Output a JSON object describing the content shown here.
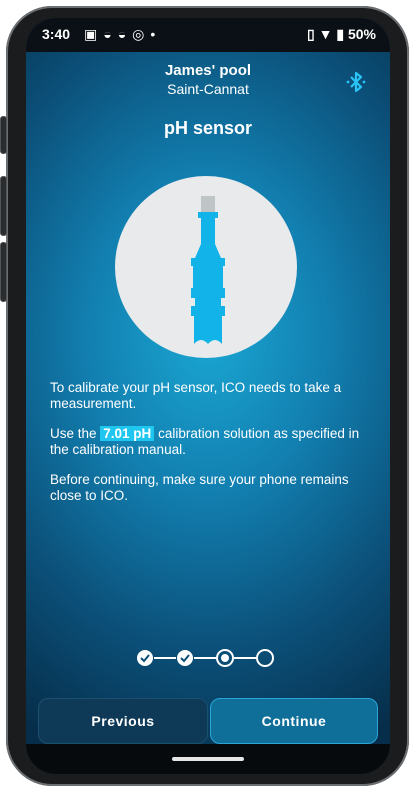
{
  "status_bar": {
    "time": "3:40",
    "left_icons": [
      "image-icon",
      "cloud-icon",
      "cloud-icon",
      "data-saver-icon",
      "dot-icon"
    ],
    "right_icons": [
      "vibrate-icon",
      "wifi-icon",
      "battery-icon"
    ],
    "battery": "50%"
  },
  "header": {
    "pool_name": "James' pool",
    "location": "Saint-Cannat"
  },
  "page_title": "pH sensor",
  "instructions": {
    "p1": "To calibrate your pH sensor, ICO needs to take a measurement.",
    "p2_before": "Use the ",
    "p2_highlight": "7.01 pH",
    "p2_after": " calibration solution as specified in the calibration manual.",
    "p3": "Before continuing, make sure your phone remains close to ICO."
  },
  "progress": {
    "steps": [
      "done",
      "done",
      "current",
      "pending"
    ]
  },
  "buttons": {
    "previous": "Previous",
    "continue": "Continue"
  },
  "colors": {
    "accent": "#1fc6ef",
    "background_dark": "#062e4a"
  }
}
